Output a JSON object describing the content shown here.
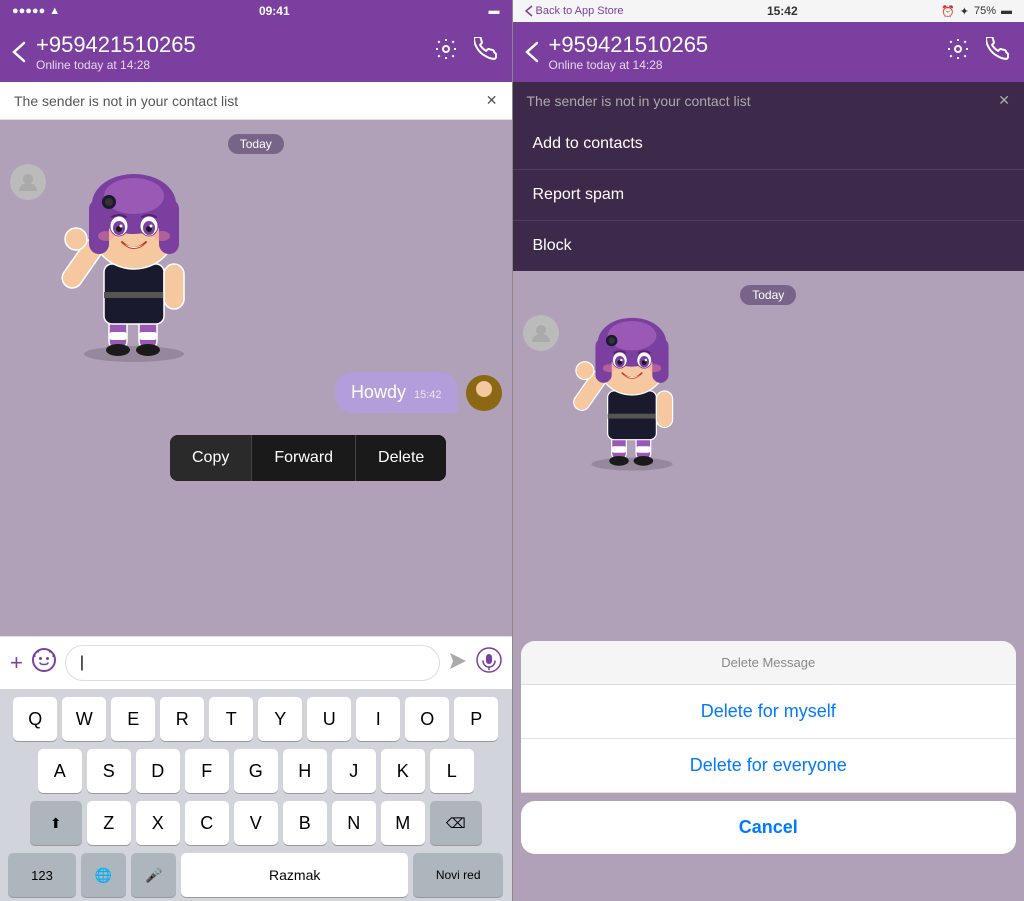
{
  "left": {
    "statusBar": {
      "time": "09:41",
      "signals": "●●●●●",
      "wifi": "WiFi"
    },
    "header": {
      "phone": "+959421510265",
      "status": "Online today at 14:28",
      "backIcon": "‹",
      "settingsIcon": "⚙",
      "callIcon": "📞"
    },
    "warning": {
      "text": "The sender is not in your contact list",
      "closeIcon": "✕"
    },
    "chat": {
      "dateBadge": "Today",
      "howdyText": "Howdy",
      "howdyTime": "15:42"
    },
    "contextMenu": {
      "copy": "Copy",
      "forward": "Forward",
      "delete": "Delete"
    },
    "inputPlaceholder": "",
    "keyboard": {
      "row1": [
        "Q",
        "W",
        "E",
        "R",
        "T",
        "Y",
        "U",
        "I",
        "O",
        "P"
      ],
      "row2": [
        "A",
        "S",
        "D",
        "F",
        "G",
        "H",
        "J",
        "K",
        "L"
      ],
      "row3": [
        "Z",
        "X",
        "C",
        "V",
        "B",
        "N",
        "M"
      ],
      "bottomLeft": "123",
      "bottomGlobe": "🌐",
      "bottomMic": "🎤",
      "bottomSpace": "Razmak",
      "bottomReturn": "Novi red",
      "shiftIcon": "⬆",
      "deleteIcon": "⌫"
    }
  },
  "right": {
    "statusBar": {
      "backLabel": "Back to App Store",
      "time": "15:42",
      "battery": "75%",
      "batteryIcon": "🔋"
    },
    "header": {
      "phone": "+959421510265",
      "status": "Online today at 14:28"
    },
    "warning": {
      "text": "The sender is not in your contact list",
      "closeIcon": "✕"
    },
    "dropdown": {
      "addContacts": "Add to contacts",
      "reportSpam": "Report spam",
      "block": "Block"
    },
    "chat": {
      "dateBadge": "Today"
    },
    "deleteModal": {
      "title": "Delete Message",
      "deleteForMyself": "Delete for myself",
      "deleteForEveryone": "Delete for everyone",
      "cancel": "Cancel"
    }
  }
}
